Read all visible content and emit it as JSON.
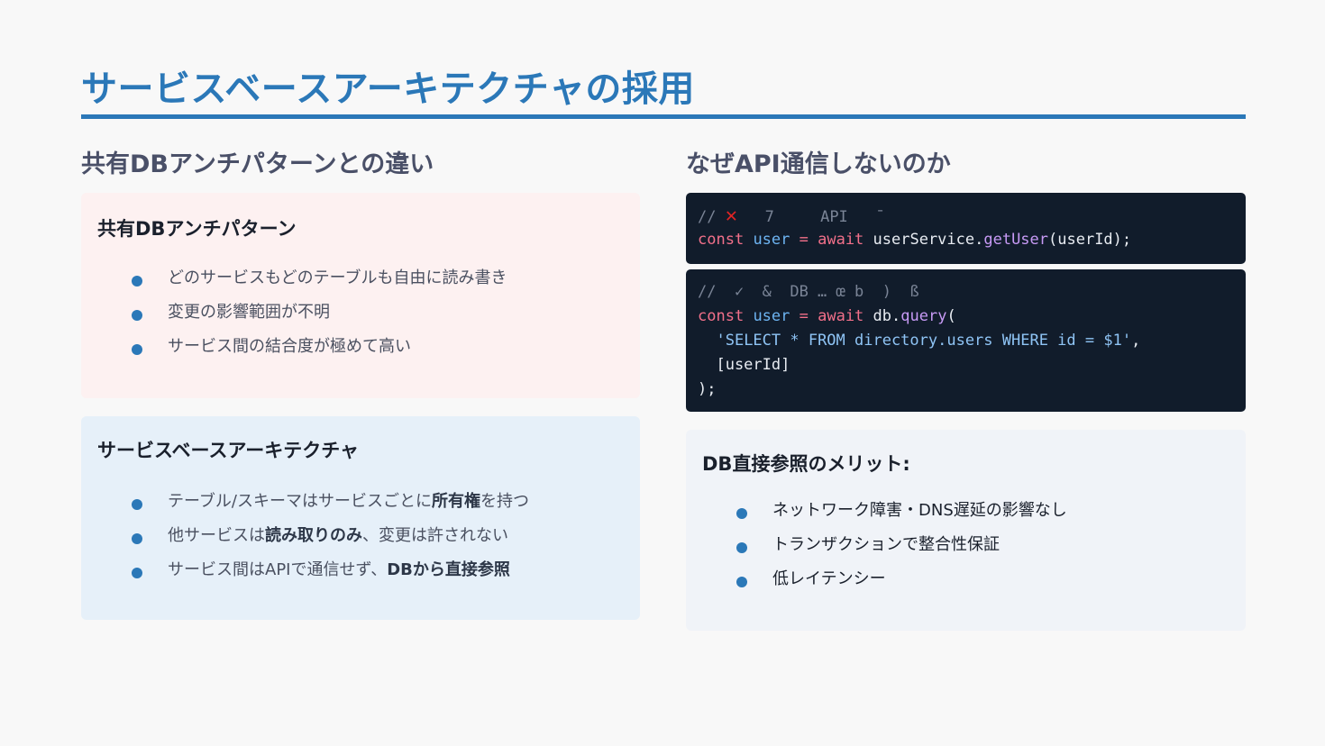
{
  "title": "サービスベースアーキテクチャの採用",
  "left": {
    "heading": "共有DBアンチパターンとの違い",
    "card1": {
      "title": "共有DBアンチパターン",
      "items": [
        "どのサービスもどのテーブルも自由に読み書き",
        "変更の影響範囲が不明",
        "サービス間の結合度が極めて高い"
      ]
    },
    "card2": {
      "title": "サービスベースアーキテクチャ",
      "items": [
        {
          "pre": "テーブル/スキーマはサービスごとに",
          "bold": "所有権",
          "post": "を持つ"
        },
        {
          "pre": "他サービスは",
          "bold": "読み取りのみ",
          "post": "、変更は許されない"
        },
        {
          "pre": "サービス間はAPIで通信せず、",
          "bold": "DBから直接参照",
          "post": ""
        }
      ]
    }
  },
  "right": {
    "heading": "なぜAPI通信しないのか",
    "code1": {
      "comment_prefix": "// ",
      "mark": "✕",
      "comment_rest": "   7     API   ˉ",
      "kw_const": "const",
      "var": "user",
      "op": " = ",
      "kw_await": "await",
      "obj": " userService.",
      "fn": "getUser",
      "args": "(userId);"
    },
    "code2": {
      "comment": "//  ✓  &  DB … œ b  )  ß",
      "kw_const": "const",
      "var": "user",
      "op": " = ",
      "kw_await": "await",
      "obj": " db.",
      "fn": "query",
      "open": "(",
      "indent": "  ",
      "sql": "'SELECT * FROM directory.users WHERE id = $1'",
      "comma": ",",
      "param": "  [userId]",
      "close": ");"
    },
    "merits": {
      "title": "DB直接参照のメリット:",
      "items": [
        "ネットワーク障害・DNS遅延の影響なし",
        "トランザクションで整合性保証",
        "低レイテンシー"
      ]
    }
  },
  "colors": {
    "accent": "#2b78b8",
    "card_pink": "#fdf1f1",
    "card_blue": "#e6f0f9",
    "card_gray": "#f0f3f8",
    "code_bg": "#111c2b"
  }
}
